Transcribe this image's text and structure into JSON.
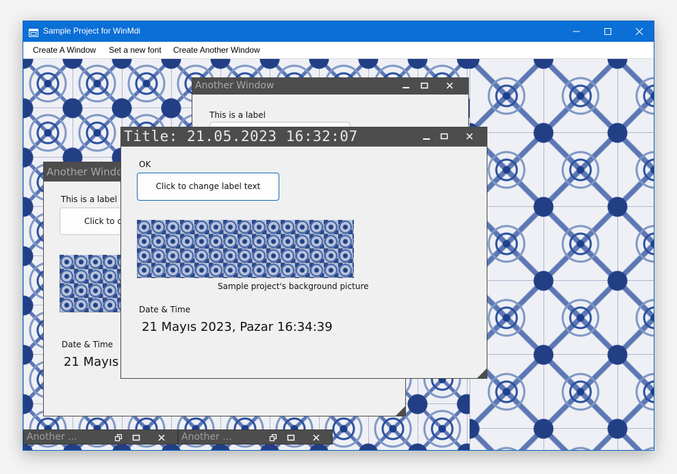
{
  "window": {
    "title": "Sample Project for WinMdi",
    "icon": "mdi-app-icon",
    "accent": "#0a6fd6"
  },
  "menu": {
    "items": [
      {
        "label": "Create A Window"
      },
      {
        "label": "Set a new font"
      },
      {
        "label": "Create Another Window"
      }
    ]
  },
  "background": {
    "pattern": "blue-white-ceramic-tiles",
    "colors": [
      "#1d3f8c",
      "#eef0f5"
    ]
  },
  "children": {
    "left_window": {
      "title": "Another Window",
      "label": "This is a label",
      "button": "Click to ch",
      "date_caption": "Date & Time",
      "datetime": "21 Mayıs 2"
    },
    "top_window": {
      "title": "Another Window",
      "label": "This is a label"
    },
    "front_window": {
      "title": "Title: 21.05.2023 16:32:07",
      "label": "OK",
      "button": "Click to change label text",
      "picture_caption": "Sample project's background picture",
      "date_caption": "Date & Time",
      "datetime": "21 Mayıs 2023, Pazar 16:34:39"
    },
    "minimized": [
      {
        "title": "Another ..."
      },
      {
        "title": "Another ..."
      }
    ]
  },
  "icons": {
    "minimize": "minimize-icon",
    "maximize": "maximize-icon",
    "restore": "restore-icon",
    "close": "close-icon"
  }
}
